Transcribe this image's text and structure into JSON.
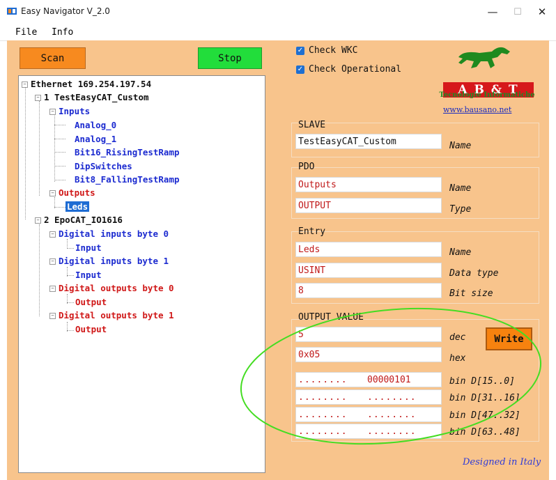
{
  "window": {
    "title": "Easy Navigator V_2.0",
    "minimize_glyph": "—",
    "maximize_glyph": "☐",
    "close_glyph": "✕"
  },
  "menu": {
    "file": "File",
    "info": "Info"
  },
  "buttons": {
    "scan": "Scan",
    "stop": "Stop",
    "write": "Write"
  },
  "tree": {
    "root": "Ethernet 169.254.197.54",
    "slave1": "1 TestEasyCAT_Custom",
    "inputs": "Inputs",
    "in_items": [
      "Analog_0",
      "Analog_1",
      "Bit16_RisingTestRamp",
      "DipSwitches",
      "Bit8_FallingTestRamp"
    ],
    "outputs": "Outputs",
    "leds": "Leds",
    "slave2": "2 EpoCAT_IO1616",
    "din0": "Digital inputs byte 0",
    "din0_child": "Input",
    "din1": "Digital inputs byte 1",
    "din1_child": "Input",
    "dout0": "Digital outputs byte 0",
    "dout0_child": "Output",
    "dout1": "Digital outputs byte 1",
    "dout1_child": "Output"
  },
  "checks": {
    "wkc": "Check WKC",
    "operational": "Check Operational",
    "checkmark": "✓"
  },
  "logo": {
    "letters": "A B & T",
    "subtitle": "Tecnologie Informatiche",
    "url": "www.bausano.net"
  },
  "slave": {
    "title": "SLAVE",
    "name_value": "TestEasyCAT_Custom",
    "name_label": "Name"
  },
  "pdo": {
    "title": "PDO",
    "name_value": "Outputs",
    "name_label": "Name",
    "type_value": "OUTPUT",
    "type_label": "Type"
  },
  "entry": {
    "title": "Entry",
    "name_value": "Leds",
    "name_label": "Name",
    "dtype_value": "USINT",
    "dtype_label": "Data type",
    "bits_value": "8",
    "bits_label": "Bit size"
  },
  "output_value": {
    "title": "OUTPUT VALUE",
    "dec_value": "5",
    "dec_label": "dec",
    "hex_value": "0x05",
    "hex_label": "hex",
    "bin": [
      {
        "left": "........",
        "right": "00000101",
        "label": "bin D[15..0]"
      },
      {
        "left": "........",
        "right": "........",
        "label": "bin D[31..16]"
      },
      {
        "left": "........",
        "right": "........",
        "label": "bin D[47..32]"
      },
      {
        "left": "........",
        "right": "........",
        "label": "bin D[63..48]"
      }
    ]
  },
  "footer": {
    "designed": "Designed in Italy"
  },
  "colors": {
    "panel": "#f8c48c",
    "scan": "#f78a1f",
    "stop": "#22dd3b",
    "write": "#f7820f",
    "highlight": "#1e6cd3",
    "annotation": "#44dd22"
  }
}
